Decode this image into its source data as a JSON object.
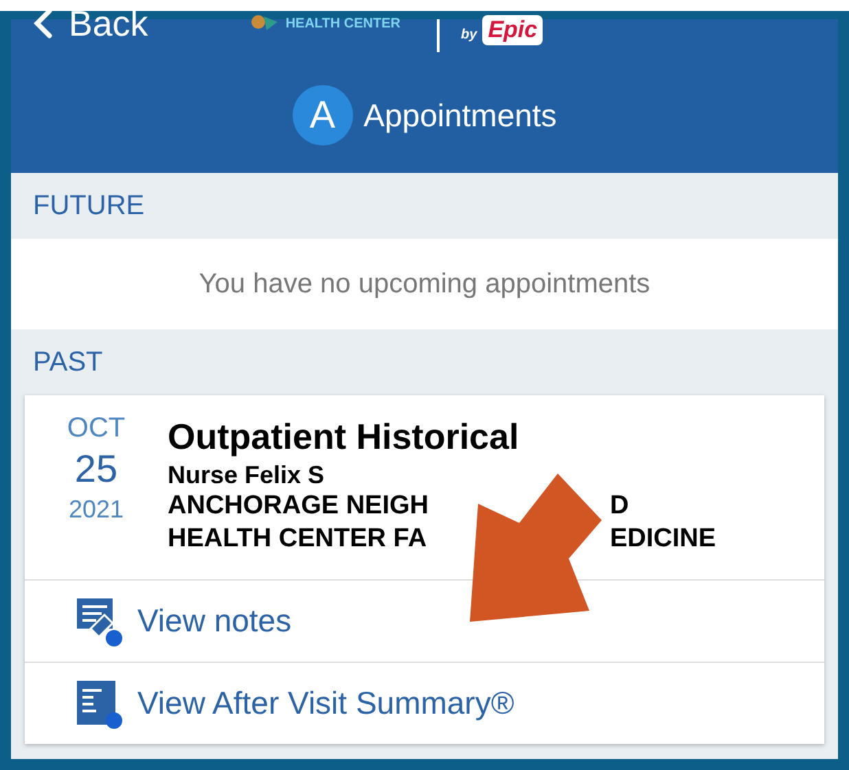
{
  "header": {
    "back": "Back",
    "logo_text": "HEALTH CENTER",
    "by": "by",
    "brand": "Epic",
    "avatar": "A",
    "title": "Appointments"
  },
  "sections": [
    {
      "heading": "FUTURE",
      "empty_message": "You have no upcoming appointments"
    },
    {
      "heading": "PAST",
      "appointments": [
        {
          "month": "OCT",
          "day": "25",
          "year": "2021",
          "title": "Outpatient Historical",
          "provider": "Nurse Felix S",
          "location_lines": [
            [
              "ANCHORAGE NEIGH",
              "D"
            ],
            [
              "HEALTH CENTER FA",
              "EDICINE"
            ]
          ],
          "actions": [
            {
              "kind": "notes",
              "label": "View notes"
            },
            {
              "kind": "summary",
              "label": "View After Visit Summary®"
            }
          ]
        }
      ]
    }
  ]
}
